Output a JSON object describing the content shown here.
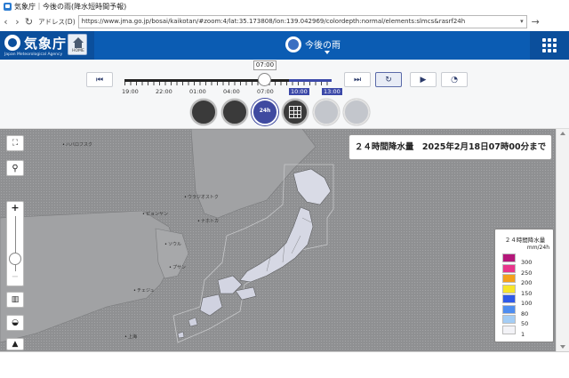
{
  "window": {
    "title": "気象庁｜今後の雨(降水短時間予報)"
  },
  "addressbar": {
    "back": "‹",
    "forward": "›",
    "reload": "↻",
    "label": "アドレス(D)",
    "url": "https://www.jma.go.jp/bosai/kaikotan/#zoom:4/lat:35.173808/lon:139.042969/colordepth:normal/elements:slmcs&rasrf24h",
    "go": "→"
  },
  "header": {
    "logo_text": "気象庁",
    "logo_sub": "Japan Meteorological Agency",
    "home_label": "HOME",
    "page_title": "今後の雨",
    "accent": "#0b4f9c"
  },
  "controls": {
    "current_time": "07:00",
    "tick_labels": [
      "19:00",
      "22:00",
      "01:00",
      "04:00",
      "07:00",
      "10:00",
      "13:00"
    ],
    "highlighted_ticks": [
      "10:00",
      "13:00"
    ],
    "buttons": {
      "first": "⏮",
      "last": "⏭",
      "latest": "↻",
      "play": "▶",
      "speed": "◔"
    },
    "layers": [
      {
        "label": "",
        "state": "normal"
      },
      {
        "label": "",
        "state": "normal"
      },
      {
        "label": "24h",
        "state": "active"
      },
      {
        "label": "",
        "state": "normal"
      },
      {
        "label": "",
        "state": "disabled"
      },
      {
        "label": "",
        "state": "disabled"
      }
    ]
  },
  "map": {
    "info_text": "２４時間降水量　2025年2月18日07時00分まで",
    "labels": {
      "city1": "ウラジオストク",
      "city2": "ハバロフスク",
      "city3": "ピョンヤン",
      "city4": "ソウル",
      "city5": "ナホトカ",
      "city6": "プサン",
      "city7": "チェジュ",
      "city8": "上海"
    }
  },
  "legend": {
    "title": "２４時間降水量",
    "unit": "mm/24h",
    "levels": [
      {
        "value": "300",
        "color": "#b4177a"
      },
      {
        "value": "250",
        "color": "#e8368c"
      },
      {
        "value": "200",
        "color": "#f4a11c"
      },
      {
        "value": "150",
        "color": "#f7e52a"
      },
      {
        "value": "100",
        "color": "#2f5ae8"
      },
      {
        "value": "80",
        "color": "#4e8df0"
      },
      {
        "value": "50",
        "color": "#a4cdf5"
      },
      {
        "value": "1",
        "color": "#f3f3f7"
      }
    ]
  }
}
